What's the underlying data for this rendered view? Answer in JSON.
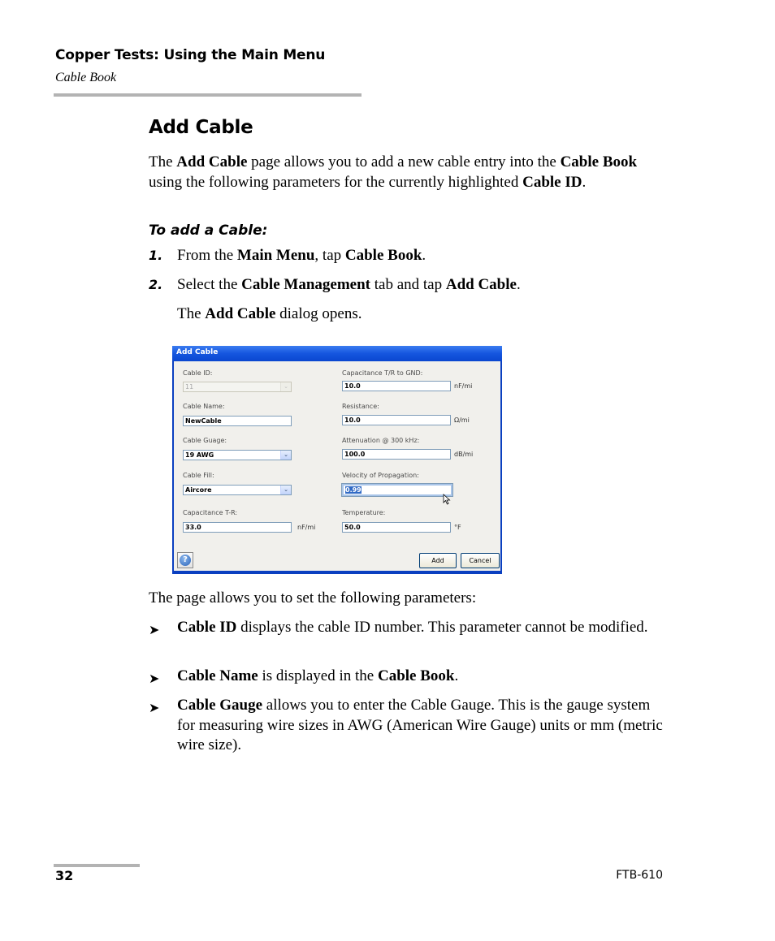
{
  "header": {
    "chapter": "Copper Tests: Using the Main Menu",
    "section": "Cable Book"
  },
  "heading": "Add Cable",
  "intro": [
    {
      "t": "The ",
      "b": false
    },
    {
      "t": "Add Cable",
      "b": true
    },
    {
      "t": " page allows you to add a new cable entry into the ",
      "b": false
    },
    {
      "t": "Cable Book",
      "b": true
    },
    {
      "t": " using the following parameters for the currently highlighted ",
      "b": false
    },
    {
      "t": "Cable ID",
      "b": true
    },
    {
      "t": ".",
      "b": false
    }
  ],
  "procedure": {
    "title": "To add a Cable:",
    "steps": [
      {
        "num": "1.",
        "parts": [
          {
            "t": "From the ",
            "b": false
          },
          {
            "t": "Main Menu",
            "b": true
          },
          {
            "t": ", tap ",
            "b": false
          },
          {
            "t": "Cable Book",
            "b": true
          },
          {
            "t": ".",
            "b": false
          }
        ]
      },
      {
        "num": "2.",
        "parts": [
          {
            "t": "Select the ",
            "b": false
          },
          {
            "t": "Cable Management",
            "b": true
          },
          {
            "t": " tab and tap ",
            "b": false
          },
          {
            "t": "Add Cable",
            "b": true
          },
          {
            "t": ".",
            "b": false
          }
        ]
      }
    ],
    "note": [
      {
        "t": "The ",
        "b": false
      },
      {
        "t": "Add Cable",
        "b": true
      },
      {
        "t": " dialog opens.",
        "b": false
      }
    ]
  },
  "dialog": {
    "title": "Add Cable",
    "left_fields": {
      "cable_id": {
        "label": "Cable ID:",
        "value": "11",
        "disabled": true
      },
      "cable_name": {
        "label": "Cable Name:",
        "value": "NewCable"
      },
      "cable_gauge": {
        "label": "Cable Guage:",
        "value": "19 AWG"
      },
      "cable_fill": {
        "label": "Cable Fill:",
        "value": "Aircore"
      },
      "capacitance_tr": {
        "label": "Capacitance T-R:",
        "value": "33.0",
        "unit": "nF/mi"
      }
    },
    "right_fields": {
      "capacitance_gnd": {
        "label": "Capacitance T/R to GND:",
        "value": "10.0",
        "unit": "nF/mi"
      },
      "resistance": {
        "label": "Resistance:",
        "value": "10.0",
        "unit": "Ω/mi"
      },
      "attenuation": {
        "label": "Attenuation @ 300 kHz:",
        "value": "100.0",
        "unit": "dB/mi"
      },
      "velocity": {
        "label": "Velocity of Propagation:",
        "value": "0.99"
      },
      "temperature": {
        "label": "Temperature:",
        "value": "50.0",
        "unit": "°F"
      }
    },
    "dropdown_glyph": "⌄",
    "help_glyph": "?",
    "add_label": "Add",
    "cancel_label": "Cancel"
  },
  "params_intro": "The page allows you to set the following parameters:",
  "bullet_glyph": "➤",
  "bullets": [
    [
      {
        "t": "Cable ID",
        "b": true
      },
      {
        "t": " displays the cable ID number. This parameter cannot be modified.",
        "b": false
      }
    ],
    [
      {
        "t": "Cable Name",
        "b": true
      },
      {
        "t": " is displayed in the ",
        "b": false
      },
      {
        "t": "Cable Book",
        "b": true
      },
      {
        "t": ".",
        "b": false
      }
    ],
    [
      {
        "t": "Cable Gauge",
        "b": true
      },
      {
        "t": " allows you to enter the Cable Gauge. This is the gauge system for measuring wire sizes in AWG (American Wire Gauge) units or mm (metric wire size).",
        "b": false
      }
    ]
  ],
  "footer": {
    "page_number": "32",
    "doc_id": "FTB-610"
  }
}
